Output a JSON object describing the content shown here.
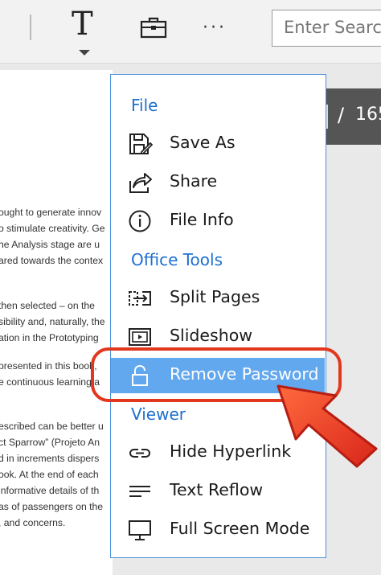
{
  "toolbar": {
    "text_tool_glyph": "T",
    "more_glyph": "···",
    "search_placeholder": "Enter Search"
  },
  "document": {
    "lines": [
      "ought to generate innov",
      "o stimulate creativity. Ge",
      "he Analysis stage are u",
      "ared towards the contex",
      " then selected – on the",
      "sibility and, naturally, the",
      "ation in the Prototyping",
      " presented in this book,",
      "e continuous learning a",
      "escribed can be better u",
      "ct Sparrow” (Projeto An",
      "d in increments dispers",
      "ook. At the end of each",
      "informative details of th",
      "as of passengers on the",
      ", and concerns."
    ]
  },
  "page_nav": {
    "separator": "/",
    "total": "165"
  },
  "menu": {
    "sections": [
      {
        "header": "File",
        "items": [
          {
            "label": "Save As",
            "icon": "save-as-icon"
          },
          {
            "label": "Share",
            "icon": "share-icon"
          },
          {
            "label": "File Info",
            "icon": "info-icon"
          }
        ]
      },
      {
        "header": "Office Tools",
        "items": [
          {
            "label": "Split Pages",
            "icon": "split-pages-icon"
          },
          {
            "label": "Slideshow",
            "icon": "slideshow-icon"
          },
          {
            "label": "Remove Password",
            "icon": "unlock-icon",
            "active": true
          }
        ]
      },
      {
        "header": "Viewer",
        "items": [
          {
            "label": "Hide Hyperlink",
            "icon": "link-icon"
          },
          {
            "label": "Text Reflow",
            "icon": "text-reflow-icon"
          },
          {
            "label": "Full Screen Mode",
            "icon": "monitor-icon"
          }
        ]
      }
    ]
  },
  "colors": {
    "accent": "#1e6fd0",
    "active_item": "#62a8ef",
    "annotation": "#e2371f"
  }
}
